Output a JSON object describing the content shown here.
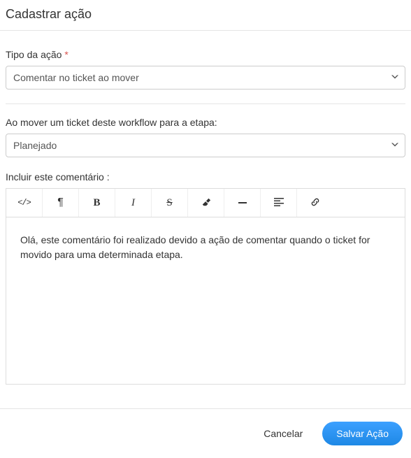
{
  "page": {
    "title": "Cadastrar ação"
  },
  "form": {
    "action_type": {
      "label": "Tipo da ação",
      "required_mark": "*",
      "selected": "Comentar no ticket ao mover"
    },
    "move_stage": {
      "label": "Ao mover um ticket deste workflow para a etapa:",
      "selected": "Planejado"
    },
    "comment_field": {
      "label": "Incluir este comentário :",
      "content": "Olá, este comentário foi realizado devido a ação de comentar  quando o ticket for movido para uma determinada etapa."
    }
  },
  "toolbar": {
    "code": "</>",
    "paragraph": "¶",
    "bold": "B",
    "italic": "I",
    "strike": "S"
  },
  "footer": {
    "cancel": "Cancelar",
    "save": "Salvar Ação"
  }
}
